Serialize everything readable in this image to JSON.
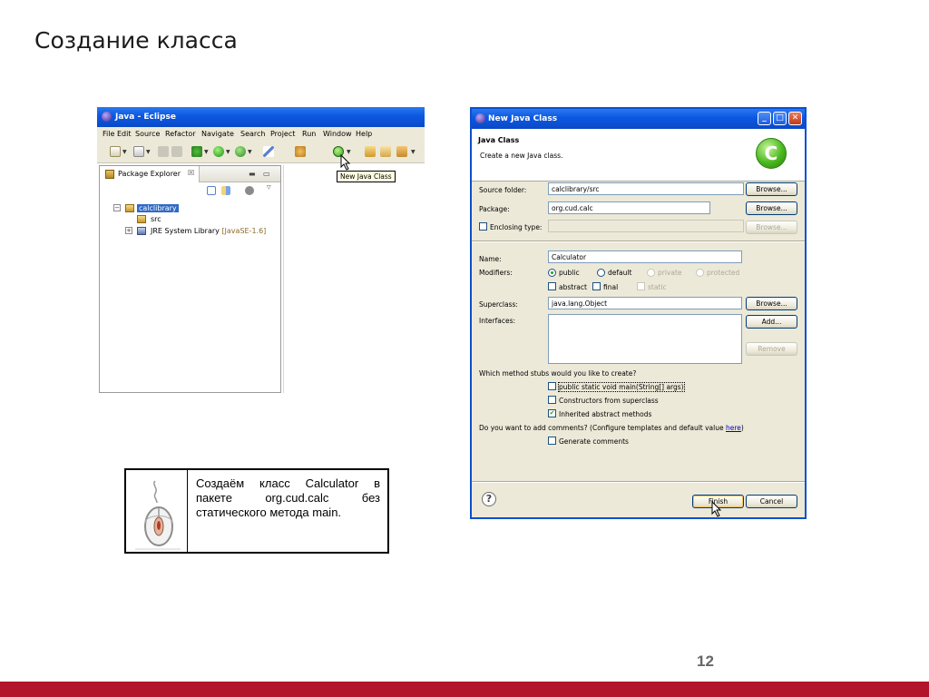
{
  "slide": {
    "title": "Создание класса",
    "page_number": "12",
    "accent_color": "#b1142b"
  },
  "eclipse": {
    "window_title": "Java - Eclipse",
    "menu": [
      "File",
      "Edit",
      "Source",
      "Refactor",
      "Navigate",
      "Search",
      "Project",
      "Run",
      "Window",
      "Help"
    ],
    "view_tab_label": "Package Explorer",
    "view_tab_close": "☒",
    "tree": {
      "project": "calclibrary",
      "src": "src",
      "jre_label": "JRE System Library",
      "jre_version": "[JavaSE-1.6]"
    },
    "tooltip": "New Java Class"
  },
  "dialog": {
    "window_title": "New Java Class",
    "header_title": "Java Class",
    "header_subtitle": "Create a new Java class.",
    "class_icon_letter": "C",
    "source_folder_label": "Source folder:",
    "source_folder_value": "calclibrary/src",
    "package_label": "Package:",
    "package_value": "org.cud.calc",
    "enclosing_type_label": "Enclosing type:",
    "name_label": "Name:",
    "name_value": "Calculator",
    "modifiers_label": "Modifiers:",
    "modifiers": {
      "public": "public",
      "default": "default",
      "private": "private",
      "protected": "protected",
      "abstract": "abstract",
      "final": "final",
      "static": "static"
    },
    "superclass_label": "Superclass:",
    "superclass_value": "java.lang.Object",
    "interfaces_label": "Interfaces:",
    "browse_label": "Browse...",
    "add_label": "Add...",
    "remove_label": "Remove",
    "stubs_question": "Which method stubs would you like to create?",
    "stubs": {
      "main": "public static void main(String[] args)",
      "constructors": "Constructors from superclass",
      "inherited": "Inherited abstract methods"
    },
    "comments_question_prefix": "Do you want to add comments? (Configure templates and default value ",
    "comments_question_link": "here",
    "comments_question_suffix": ")",
    "generate_comments": "Generate comments",
    "finish_label": "Finish",
    "cancel_label": "Cancel",
    "help_symbol": "?"
  },
  "caption": {
    "text": "Создаём класс Calculator в пакете org.cud.calc без статического метода main."
  }
}
